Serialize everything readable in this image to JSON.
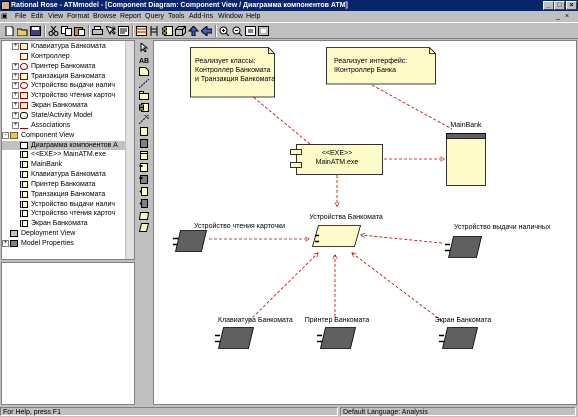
{
  "window": {
    "title": "Rational Rose - ATMmodel - [Component Diagram: Component View / Диаграмма компонентов ATM]"
  },
  "menu": [
    "File",
    "Edit",
    "View",
    "Format",
    "Browse",
    "Report",
    "Query",
    "Tools",
    "Add-Ins",
    "Window",
    "Help"
  ],
  "browser": {
    "items": [
      {
        "label": "Клавиатура Банкомата",
        "icon": "class-icon",
        "expander": "+"
      },
      {
        "label": "Контроллер",
        "icon": "class-icon",
        "expander": ""
      },
      {
        "label": "Принтер Банкомата",
        "icon": "interface-icon",
        "expander": "+"
      },
      {
        "label": "Транзакция Банкомата",
        "icon": "class-icon",
        "expander": "+"
      },
      {
        "label": "Устройство выдачи налич",
        "icon": "interface-icon",
        "expander": "+"
      },
      {
        "label": "Устройство чтения карточ",
        "icon": "class-icon",
        "expander": "+"
      },
      {
        "label": "Экран Банкомата",
        "icon": "class-icon",
        "expander": "+"
      },
      {
        "label": "State/Activity Model",
        "icon": "statechart-icon",
        "expander": "+"
      },
      {
        "label": "Associations",
        "icon": "association-icon",
        "expander": "+"
      },
      {
        "label": "Component View",
        "icon": "folder-icon",
        "expander": "-"
      },
      {
        "label": "Диаграмма компонентов А",
        "icon": "diagram-icon",
        "expander": ""
      },
      {
        "label": "<<EXE>> MainATM.exe",
        "icon": "component-icon",
        "expander": ""
      },
      {
        "label": "MainBank",
        "icon": "component-icon",
        "expander": ""
      },
      {
        "label": "Клавиатура Банкомата",
        "icon": "component-icon",
        "expander": ""
      },
      {
        "label": "Принтер Банкомата",
        "icon": "component-icon",
        "expander": ""
      },
      {
        "label": "Транзакция Банкомата",
        "icon": "component-icon",
        "expander": ""
      },
      {
        "label": "Устройство выдачи налич",
        "icon": "component-icon",
        "expander": ""
      },
      {
        "label": "Устройство чтения карточ",
        "icon": "component-icon",
        "expander": ""
      },
      {
        "label": "Экран Банкомата",
        "icon": "component-icon",
        "expander": ""
      },
      {
        "label": "Deployment View",
        "icon": "deployment-icon",
        "expander": ""
      },
      {
        "label": "Model Properties",
        "icon": "properties-icon",
        "expander": "+"
      }
    ]
  },
  "diagram": {
    "note1": {
      "lines": [
        "Реализует классы:",
        "Контроллер Банкомата",
        "и Транзакция Банкомата"
      ]
    },
    "note2": {
      "lines": [
        "Реализует интерфейс:",
        "IКонтроллер Банка"
      ]
    },
    "exe": {
      "stereotype": "<<EXE>>",
      "name": "MainATM.exe"
    },
    "mainbank": {
      "label": "MainBank"
    },
    "center": {
      "label": "Устройства Банкомата"
    },
    "cardreader": {
      "label": "Устройство чтения карточки"
    },
    "cashdispenser": {
      "label": "Устройство выдачи наличных"
    },
    "keyboard": {
      "label": "Клавиатура Банкомата"
    },
    "printer": {
      "label": "Принтер Банкомата"
    },
    "screen": {
      "label": "Экран Банкомата"
    }
  },
  "status": {
    "help": "For Help, press F1",
    "language": "Default Language: Analysis"
  },
  "colors": {
    "title_bg": "#08246b",
    "component_fill": "#fffbc9",
    "note_fill": "#fffbc9",
    "subsystem_fill": "#606060",
    "dependency": "#c00000"
  }
}
